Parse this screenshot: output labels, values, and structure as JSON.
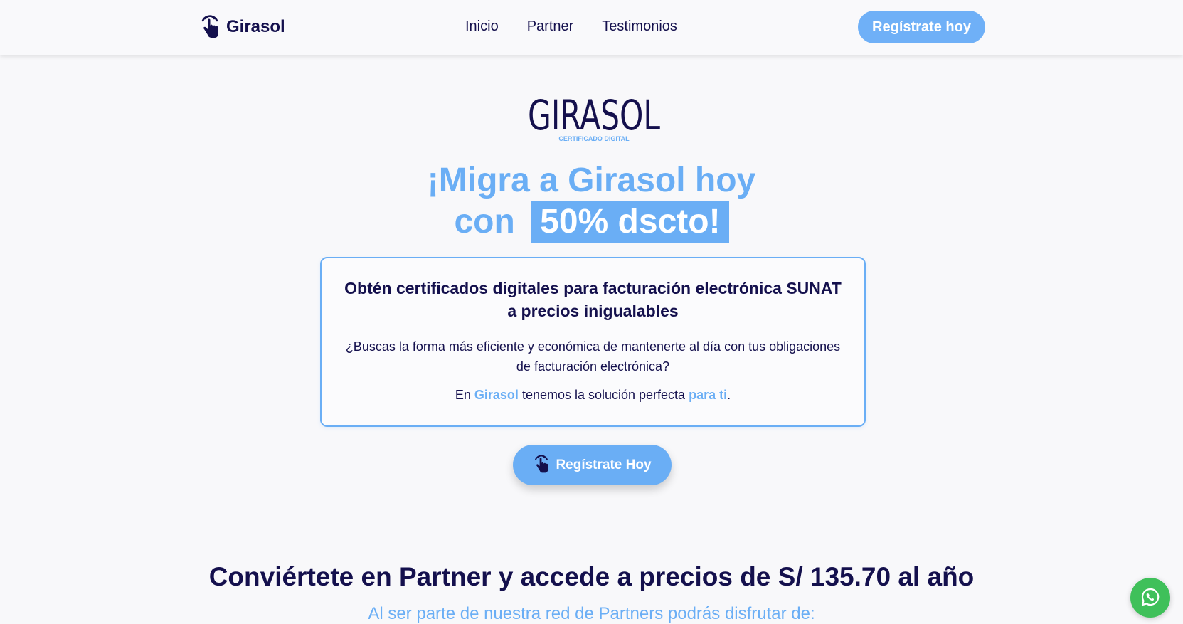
{
  "navbar": {
    "brand": "Girasol",
    "links": [
      "Inicio",
      "Partner",
      "Testimonios"
    ],
    "cta": "Regístrate hoy"
  },
  "hero": {
    "logo_text": "GIRASOL",
    "logo_tagline": "CERTIFICADO DIGITAL",
    "headline_line1": "¡Migra a Girasol hoy",
    "headline_line2_prefix": "con",
    "headline_highlight": "50% dscto!",
    "card": {
      "title": "Obtén certificados digitales para facturación electrónica SUNAT a precios inigualables",
      "text": "¿Buscas la forma más eficiente y económica de mantenerte al día con tus obligaciones de facturación electrónica?",
      "text2_prefix": "En",
      "text2_brand": "Girasol",
      "text2_middle": "tenemos la solución perfecta",
      "text2_accent": "para ti",
      "text2_end": "."
    },
    "cta": "Regístrate Hoy"
  },
  "partner_section": {
    "title": "Conviértete en Partner y accede a precios de S/ 135.70 al año",
    "subtitle": "Al ser parte de nuestra red de Partners podrás disfrutar de:"
  },
  "colors": {
    "primary_dark": "#14104d",
    "accent_blue": "#6aaef5",
    "whatsapp_green": "#3fc05a"
  },
  "icons": [
    "touch-hand-icon",
    "whatsapp-icon"
  ]
}
